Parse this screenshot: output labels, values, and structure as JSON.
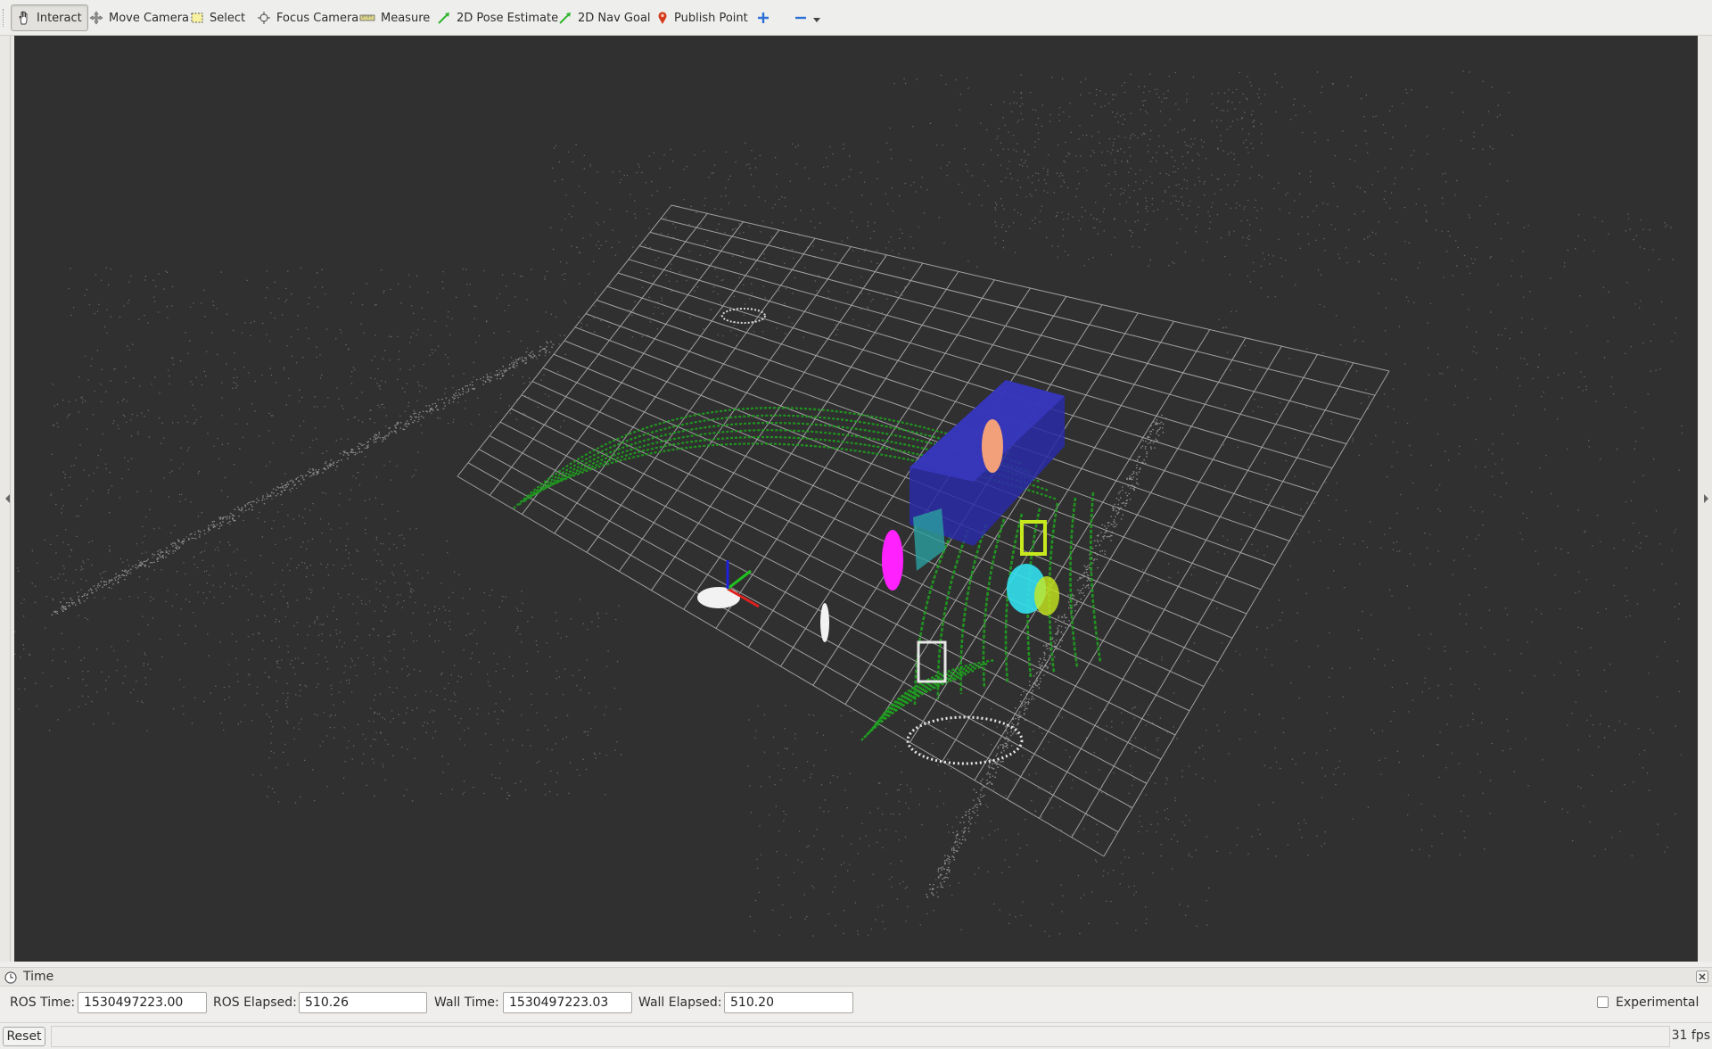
{
  "toolbar": {
    "tools": [
      {
        "label": "Interact",
        "icon": "hand-icon"
      },
      {
        "label": "Move Camera",
        "icon": "move-camera-icon"
      },
      {
        "label": "Select",
        "icon": "select-icon"
      },
      {
        "label": "Focus Camera",
        "icon": "focus-camera-icon"
      },
      {
        "label": "Measure",
        "icon": "ruler-icon"
      },
      {
        "label": "2D Pose Estimate",
        "icon": "green-arrow-icon"
      },
      {
        "label": "2D Nav Goal",
        "icon": "green-arrow-icon"
      },
      {
        "label": "Publish Point",
        "icon": "map-pin-icon"
      }
    ],
    "active_tool": "Interact"
  },
  "colors": {
    "background": "#303030",
    "grid": "#b4b4b4",
    "trajectory": "#1f9e1f",
    "bounding_box_large": "#2a2aa8",
    "bounding_box_small": "#2aa0a0",
    "person_pink": "#ff22ff",
    "person_orange": "#f2a07a",
    "cluster_cyan": "#33e0f0",
    "cluster_yellow_green": "#c8e81e"
  },
  "time_panel": {
    "title": "Time",
    "ros_time_label": "ROS Time:",
    "ros_time": "1530497223.00",
    "ros_elapsed_label": "ROS Elapsed:",
    "ros_elapsed": "510.26",
    "wall_time_label": "Wall Time:",
    "wall_time": "1530497223.03",
    "wall_elapsed_label": "Wall Elapsed:",
    "wall_elapsed": "510.20",
    "experimental_label": "Experimental",
    "experimental_checked": false
  },
  "statusbar": {
    "reset_label": "Reset",
    "fps": "31 fps"
  }
}
